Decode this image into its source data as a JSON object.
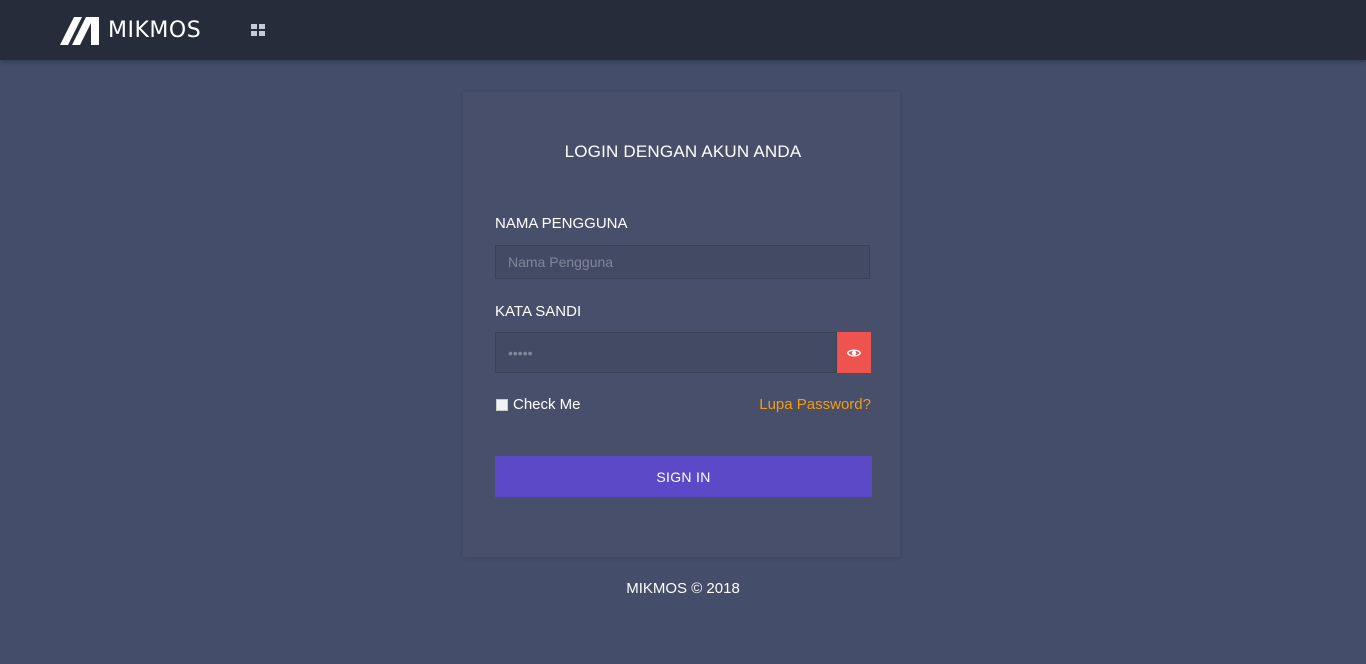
{
  "header": {
    "brand": "MIKMOS",
    "menu_icon": "grid-icon"
  },
  "login": {
    "title": "LOGIN DENGAN AKUN ANDA",
    "username_label": "NAMA PENGGUNA",
    "username_placeholder": "Nama Pengguna",
    "username_value": "",
    "password_label": "KATA SANDI",
    "password_value": "•••••",
    "show_password_icon": "eye-icon",
    "remember_label": "Check Me",
    "remember_checked": false,
    "forgot_label": "Lupa Password?",
    "submit_label": "SIGN IN"
  },
  "footer": {
    "text": "MIKMOS © 2018"
  },
  "colors": {
    "background": "#444d69",
    "topbar": "#272c3b",
    "card": "#474f6a",
    "accent_button": "#5b49c8",
    "danger_button": "#ef5350",
    "link": "#f39c12"
  }
}
